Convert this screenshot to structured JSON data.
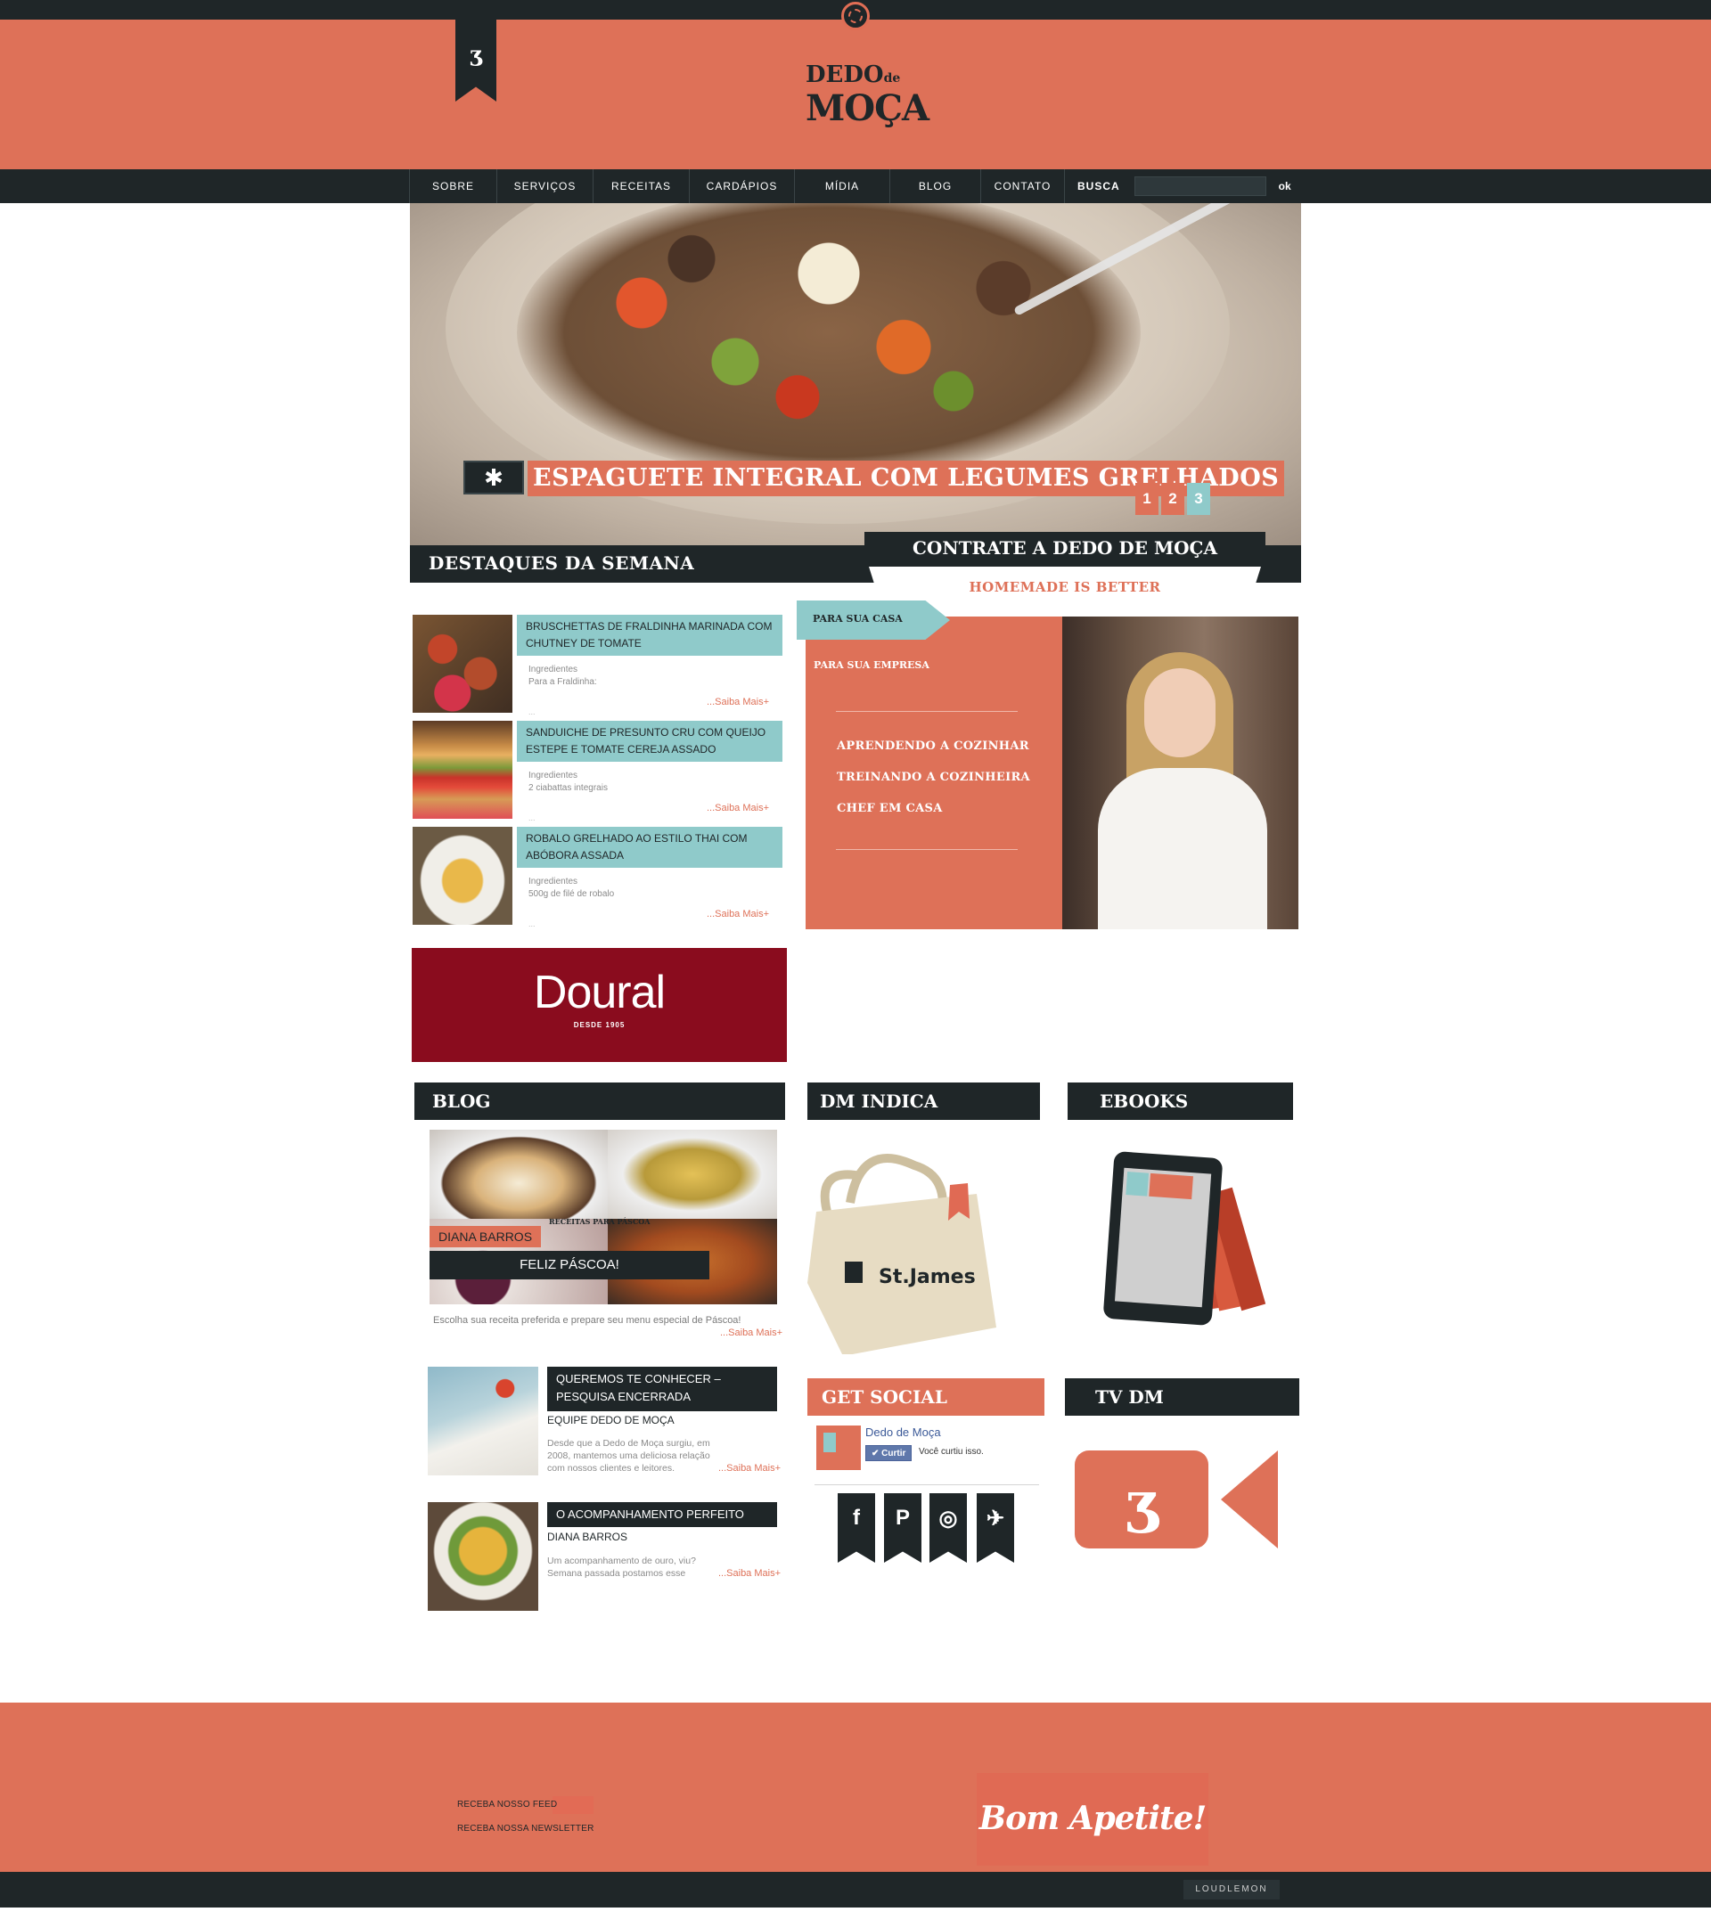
{
  "brand": {
    "logo_line1": "DEDO",
    "logo_de": "de",
    "logo_line2": "MOÇA",
    "ribbon_glyph": "ʒ"
  },
  "nav": {
    "items": [
      "SOBRE",
      "SERVIÇOS",
      "RECEITAS",
      "CARDÁPIOS",
      "MÍDIA",
      "BLOG",
      "CONTATO"
    ],
    "search_label": "BUSCA",
    "search_placeholder": "",
    "search_button": "ok"
  },
  "hero": {
    "star": "✱",
    "title": "ESPAGUETE INTEGRAL COM LEGUMES GRELHADOS",
    "pages": [
      "1",
      "2",
      "3"
    ]
  },
  "destaques": {
    "title": "DESTAQUES DA SEMANA",
    "recipes": [
      {
        "title": "BRUSCHETTAS DE FRALDINHA MARINADA COM CHUTNEY DE TOMATE",
        "ing1": "Ingredientes",
        "ing2": "Para a Fraldinha:",
        "more": "...Saiba Mais+",
        "dots": "..."
      },
      {
        "title": "SANDUICHE DE PRESUNTO CRU COM QUEIJO ESTEPE E TOMATE CEREJA ASSADO",
        "ing1": "Ingredientes",
        "ing2": "2 ciabattas integrais",
        "more": "...Saiba Mais+",
        "dots": "..."
      },
      {
        "title": "ROBALO GRELHADO AO ESTILO THAI COM ABÓBORA ASSADA",
        "ing1": "Ingredientes",
        "ing2": "500g de filé de robalo",
        "more": "...Saiba Mais+",
        "dots": "..."
      }
    ]
  },
  "contrate": {
    "title": "CONTRATE A DEDO DE MOÇA",
    "tagline": "HOMEMADE IS BETTER",
    "tab_casa": "PARA SUA CASA",
    "tab_empresa": "PARA SUA EMPRESA",
    "links": [
      "APRENDENDO A COZINHAR",
      "TREINANDO A COZINHEIRA",
      "CHEF EM CASA"
    ]
  },
  "ad": {
    "name": "Doural",
    "since": "DESDE 1905"
  },
  "blog": {
    "title": "BLOG",
    "collage_caption": "RECEITAS PARA PÁSCOA",
    "author_tag": "DIANA BARROS",
    "feature_title": "FELIZ PÁSCOA!",
    "feature_excerpt": "Escolha sua receita preferida e prepare seu menu especial de Páscoa!",
    "feature_more": "...Saiba Mais+",
    "posts": [
      {
        "title": "QUEREMOS TE CONHECER – PESQUISA ENCERRADA",
        "author": "EQUIPE DEDO DE MOÇA",
        "excerpt": "Desde que a Dedo de Moça surgiu, em 2008, mantemos uma deliciosa relação com nossos clientes e leitores.",
        "more": "...Saiba Mais+"
      },
      {
        "title": "O ACOMPANHAMENTO PERFEITO",
        "author": "DIANA BARROS",
        "excerpt": "Um acompanhamento de ouro, viu? Semana passada postamos esse",
        "more": "...Saiba Mais+"
      }
    ]
  },
  "dm_indica": {
    "title": "DM INDICA",
    "bag_brand": "St.James"
  },
  "ebooks": {
    "title": "EBOOKS"
  },
  "social": {
    "title": "GET SOCIAL",
    "page_name": "Dedo de Moça",
    "like_button": "✔ Curtir",
    "liked_text": "Você curtiu isso.",
    "buttons": [
      {
        "glyph": "f",
        "icon": "facebook-icon"
      },
      {
        "glyph": "P",
        "icon": "pinterest-icon"
      },
      {
        "glyph": "◎",
        "icon": "instagram-icon"
      },
      {
        "glyph": "✈",
        "icon": "twitter-icon"
      }
    ]
  },
  "tv": {
    "title": "TV DM",
    "glyph": "ʒ"
  },
  "footer": {
    "feed_link": "RECEBA NOSSO FEED",
    "newsletter_link": "RECEBA NOSSA NEWSLETTER",
    "slogan": "Bom Apetite!",
    "credit": "LOUDLEMON"
  },
  "colors": {
    "coral": "#de7158",
    "dark": "#1f2628",
    "teal": "#8fcaca",
    "doural_red": "#8a0c1e"
  }
}
